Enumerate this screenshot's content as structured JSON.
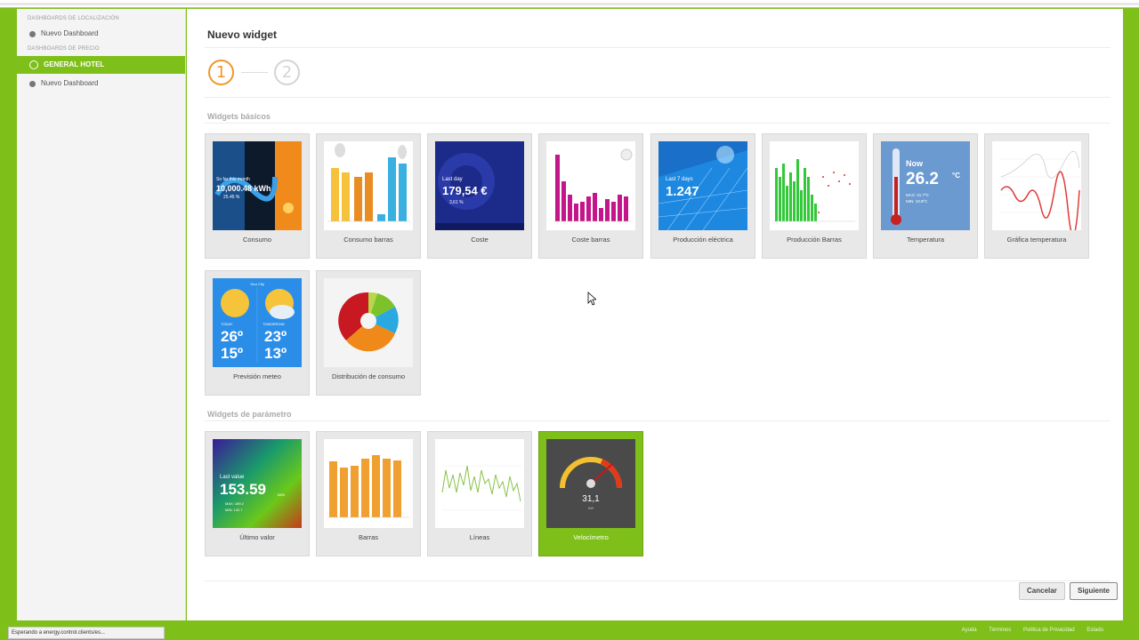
{
  "sidebar": {
    "section1": "DASHBOARDS DE LOCALIZACIÓN",
    "section1_item": "Nuevo Dashboard",
    "section2": "DASHBOARDS DE PRECIO",
    "active_item": "GENERAL HOTEL",
    "section2_item": "Nuevo Dashboard"
  },
  "main": {
    "title": "Nuevo widget",
    "steps": [
      "1",
      "2"
    ],
    "basic_section": "Widgets básicos",
    "param_section": "Widgets de parámetro",
    "basic_widgets": [
      {
        "label": "Consumo",
        "thumb_text": "So far this month",
        "thumb_value": "10,000.48 kWh",
        "thumb_sub": "25.45 %"
      },
      {
        "label": "Consumo barras"
      },
      {
        "label": "Coste",
        "thumb_text": "Last day",
        "thumb_value": "179,54 €",
        "thumb_sub": "3,61 %"
      },
      {
        "label": "Coste barras"
      },
      {
        "label": "Producción eléctrica",
        "thumb_text": "Last 7 days",
        "thumb_value": "1.247"
      },
      {
        "label": "Producción Barras"
      },
      {
        "label": "Temperatura",
        "thumb_text": "Now",
        "thumb_value": "26.2",
        "thumb_unit": "°C",
        "thumb_sub": "MAX: 31.7ºC",
        "thumb_sub2": "MIN: 19.8ºC"
      },
      {
        "label": "Gráfica temperatura"
      },
      {
        "label": "Previsión meteo",
        "thumb_text": "Your City",
        "today": "TODAY",
        "tomorrow": "TOMORROW",
        "t1_max": "26º",
        "t1_min": "15º",
        "t2_max": "23º",
        "t2_min": "13º"
      },
      {
        "label": "Distribución de consumo"
      }
    ],
    "param_widgets": [
      {
        "label": "Último valor",
        "thumb_text": "Last value",
        "thumb_value": "153.59",
        "thumb_unit": "kWh",
        "thumb_sub": "MAX: 189.2",
        "thumb_sub2": "MIN: 142.7"
      },
      {
        "label": "Barras"
      },
      {
        "label": "Líneas"
      },
      {
        "label": "Velocímetro",
        "thumb_value": "31,1",
        "thumb_unit": "kW"
      }
    ]
  },
  "buttons": {
    "cancel": "Cancelar",
    "next": "Siguiente"
  },
  "status_text": "Esperando a energy.control.clients/es...",
  "footer": [
    "Ayuda",
    "Términos",
    "Política de Privacidad",
    "Estado"
  ],
  "colors": {
    "brand_green": "#7fbf1a",
    "step_active": "#f0962a"
  }
}
